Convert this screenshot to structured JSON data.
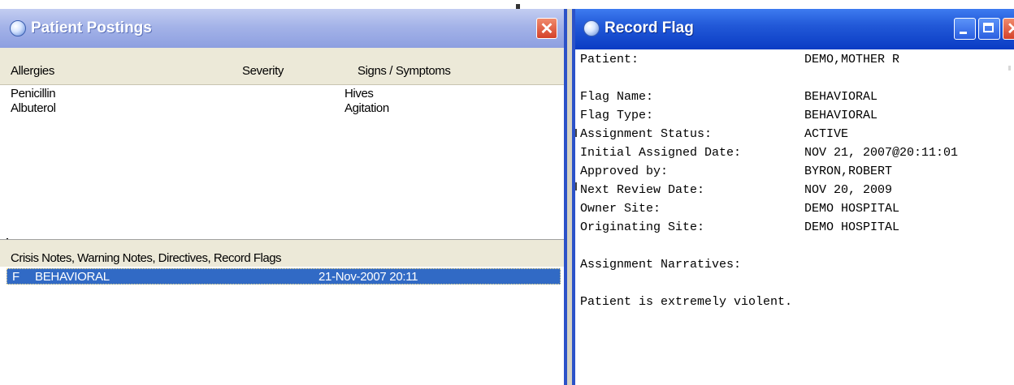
{
  "patient_postings": {
    "title": "Patient Postings",
    "close_symbol": "✕",
    "columns": {
      "allergies": "Allergies",
      "severity": "Severity",
      "signs": "Signs / Symptoms"
    },
    "rows": [
      {
        "allergy": "Penicillin",
        "severity": "",
        "signs": "Hives"
      },
      {
        "allergy": "Albuterol",
        "severity": "",
        "signs": "Agitation"
      }
    ],
    "notes_header": "Crisis Notes, Warning Notes, Directives, Record Flags",
    "notes": [
      {
        "type": "F",
        "name": "BEHAVIORAL",
        "date": "21-Nov-2007 20:11"
      }
    ]
  },
  "record_flag": {
    "title": "Record Flag",
    "close_symbol": "✕",
    "fields": [
      {
        "label": "Patient:",
        "value": "DEMO,MOTHER R"
      },
      {
        "label": "Flag Name:",
        "value": "BEHAVIORAL"
      },
      {
        "label": "Flag Type:",
        "value": "BEHAVIORAL"
      },
      {
        "label": "Assignment Status:",
        "value": "ACTIVE"
      },
      {
        "label": "Initial Assigned Date:",
        "value": "NOV 21, 2007@20:11:01"
      },
      {
        "label": "Approved by:",
        "value": "BYRON,ROBERT"
      },
      {
        "label": "Next Review Date:",
        "value": "NOV 20, 2009"
      },
      {
        "label": "Owner Site:",
        "value": "DEMO HOSPITAL"
      },
      {
        "label": "Originating Site:",
        "value": "DEMO HOSPITAL"
      }
    ],
    "narratives_label": "Assignment Narratives:",
    "narrative_text": "Patient is extremely violent."
  },
  "colors": {
    "selection": "#316ac5",
    "titlebar_active": "#0a3cc4",
    "titlebar_inactive": "#a4b3e8",
    "header_bg": "#ece9d8"
  }
}
